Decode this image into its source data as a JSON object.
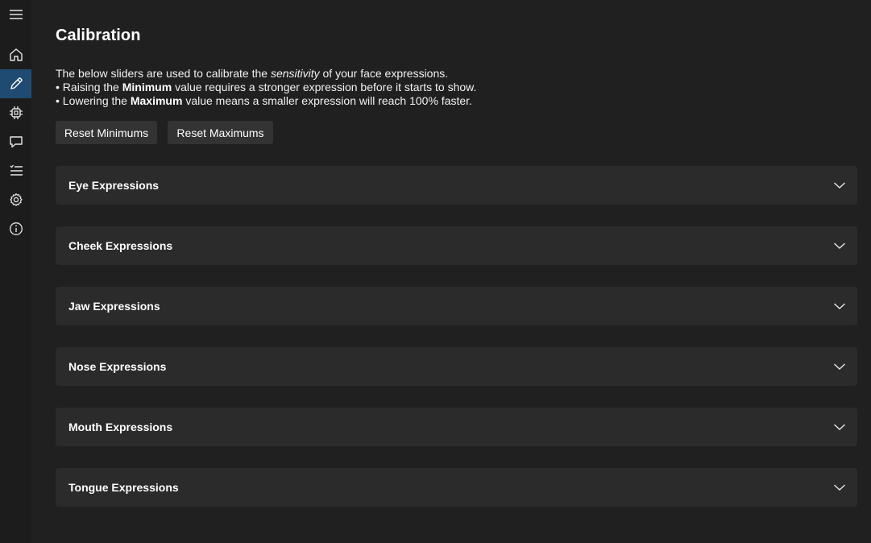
{
  "sidebar": {
    "items": [
      {
        "icon": "hamburger-menu-icon",
        "name": "menu"
      },
      {
        "icon": "home-icon",
        "name": "home"
      },
      {
        "icon": "pencil-icon",
        "name": "calibration",
        "active": true
      },
      {
        "icon": "chip-icon",
        "name": "modules"
      },
      {
        "icon": "chat-icon",
        "name": "messages"
      },
      {
        "icon": "list-icon",
        "name": "list"
      },
      {
        "icon": "gear-icon",
        "name": "settings"
      },
      {
        "icon": "info-icon",
        "name": "about"
      }
    ],
    "active_color": "#1f4b72"
  },
  "page": {
    "title": "Calibration",
    "desc": {
      "l1_a": "The below sliders are used to calibrate the ",
      "l1_em": "sensitivity",
      "l1_b": " of your face expressions.",
      "l2_a": "• Raising the ",
      "l2_strong": "Minimum",
      "l2_b": " value requires a stronger expression before it starts to show.",
      "l3_a": "• Lowering the ",
      "l3_strong": "Maximum",
      "l3_b": " value means a smaller expression will reach 100% faster."
    },
    "buttons": {
      "reset_min": "Reset Minimums",
      "reset_max": "Reset Maximums"
    }
  },
  "sections": [
    {
      "label": "Eye Expressions",
      "expanded": false
    },
    {
      "label": "Cheek Expressions",
      "expanded": false
    },
    {
      "label": "Jaw Expressions",
      "expanded": false
    },
    {
      "label": "Nose Expressions",
      "expanded": false
    },
    {
      "label": "Mouth Expressions",
      "expanded": false
    },
    {
      "label": "Tongue Expressions",
      "expanded": false
    }
  ],
  "colors": {
    "background": "#202020",
    "sidebar": "#1c1c1c",
    "panel": "#2b2b2b",
    "button": "#333333",
    "accent": "#1f4b72"
  }
}
